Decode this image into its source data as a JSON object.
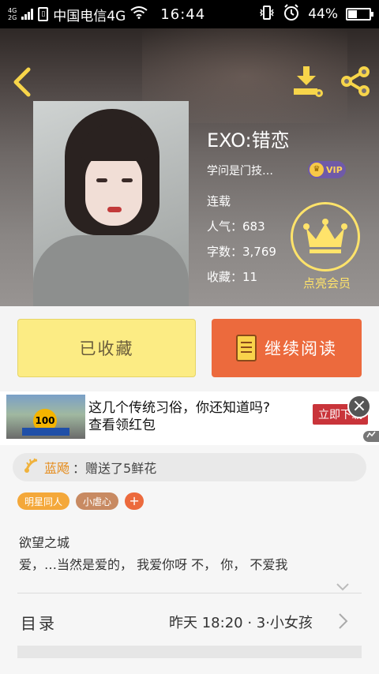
{
  "status_bar": {
    "network_top": "4G",
    "network_bottom": "2G",
    "carrier": "中国电信4G",
    "time": "16:44",
    "battery": "44%",
    "battery_level": 0.44
  },
  "book": {
    "title": "EXO:错恋",
    "author": "学问是门技…",
    "vip_label": "VIP",
    "status": "连载",
    "popularity": "人气：683",
    "word_count": "字数：3,769",
    "favorites": "收藏：11",
    "member_label": "点亮会员"
  },
  "actions": {
    "favorite_label": "已收藏",
    "read_label": "继续阅读"
  },
  "ad": {
    "thumb_number": "100",
    "line1": "这几个传统习俗，你还知道吗?",
    "line2": "查看领红包",
    "cta": "立即下载"
  },
  "gift": {
    "user": "蓝飏",
    "message": "：赠送了5鲜花"
  },
  "tags": [
    "明星同人",
    "小虐心"
  ],
  "tag_add": "+",
  "description": {
    "line1": "欲望之城",
    "line2": "爱，…当然是爱的，  我爱你呀 不，  你，  不爱我"
  },
  "toc": {
    "label": "目录",
    "latest": "昨天 18:20 · 3·小女孩"
  },
  "colors": {
    "accent_orange": "#ec6a3d",
    "favorite_yellow": "#fcec84",
    "member_yellow": "#ffe36a"
  }
}
